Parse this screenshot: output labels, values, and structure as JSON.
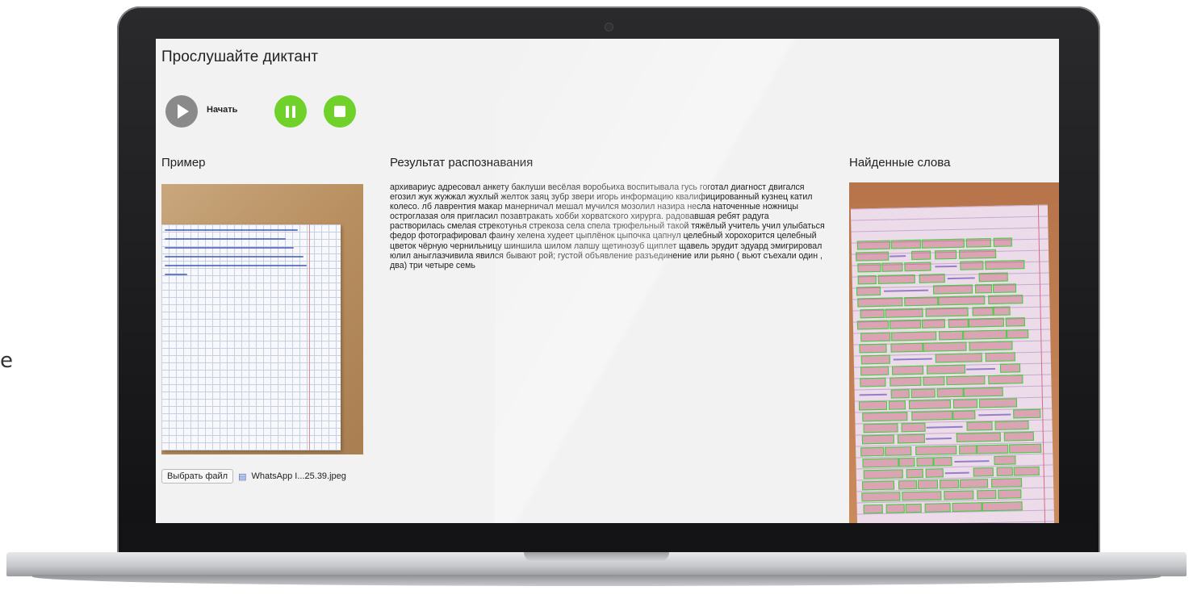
{
  "app": {
    "title": "Прослушайте диктант",
    "controls": {
      "play_label": "Начать",
      "colors": {
        "play": "#8a8a8a",
        "pause": "#6fd12a",
        "stop": "#6fd12a"
      }
    },
    "sections": {
      "example": "Пример",
      "result": "Результат распознавания",
      "found": "Найденные слова"
    },
    "file": {
      "button_label": "Выбрать файл",
      "file_name": "WhatsApp I...25.39.jpeg"
    },
    "recognition_result": "архивариус адресовал анкету баклуши весёлая воробьиха воспитывала гусь гоготал диагност двигался егозил жук жужжал жухлый желток заяц зубр звери игорь информацию квалифицированный кузнец катил колесо. лб лаврентия макар манерничал мешал мучился мозолил назира несла наточенные ножницы остроглазая оля пригласил позавтракать хобби хорватского хирурга. радовавшая ребят радуга растворилась смелая стрекотунья стрекоза села спела трюфельный такой тяжёлый учитель учил улыбаться федор фотографировал фаину хелена худеет цыплёнок цыпочка цапнул целебный хорохорится целебный цветок чёрную чернильницу шиншила шилом лапшу щетинозуб щиплет щавель эрудит эдуард эмигрировал юлил аныглазчивила явился бывают рой; густой объявление разъединение или рьяно ( вьют съехали один , два) три четыре семь"
  },
  "icons": {
    "play": "play-icon",
    "pause": "pause-icon",
    "stop": "stop-icon",
    "file": "file-icon"
  },
  "images": {
    "example_handwriting": [
      "Компьютеры изменили технологию письма .",
      "С помощью специальных компьютерных",
      "программ можно набрать любой текст ,",
      "внести в него изменения , записать текст в",
      "память компьютера , распечатать на прин-",
      "тере ."
    ]
  }
}
